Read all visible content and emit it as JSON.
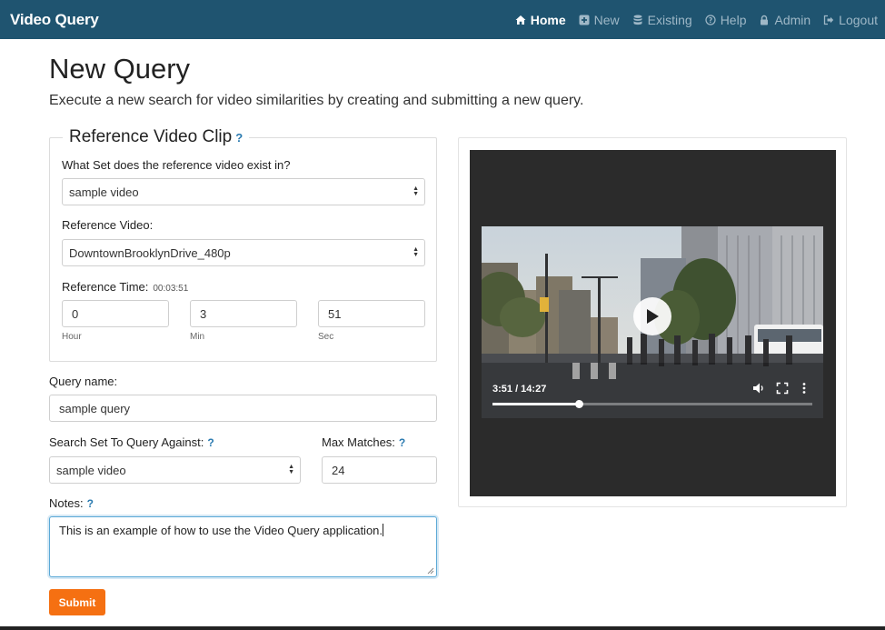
{
  "navbar": {
    "brand": "Video Query",
    "items": [
      {
        "label": "Home",
        "icon": "home-icon"
      },
      {
        "label": "New",
        "icon": "plus-square-icon"
      },
      {
        "label": "Existing",
        "icon": "database-icon"
      },
      {
        "label": "Help",
        "icon": "question-circle-icon"
      },
      {
        "label": "Admin",
        "icon": "lock-icon"
      },
      {
        "label": "Logout",
        "icon": "sign-out-icon"
      }
    ],
    "active": "Home",
    "bg_color": "#1f5470"
  },
  "page": {
    "title": "New Query",
    "subtitle": "Execute a new search for video similarities by creating and submitting a new query."
  },
  "reference": {
    "legend": "Reference Video Clip",
    "help": "?",
    "set_label": "What Set does the reference video exist in?",
    "set_value": "sample video",
    "video_label": "Reference Video:",
    "video_value": "DowntownBrooklynDrive_480p",
    "time_label": "Reference Time:",
    "time_value": "00:03:51",
    "hour": "0",
    "min": "3",
    "sec": "51",
    "hour_hint": "Hour",
    "min_hint": "Min",
    "sec_hint": "Sec"
  },
  "query": {
    "name_label": "Query name:",
    "name_value": "sample query",
    "search_set_label": "Search Set To Query Against:",
    "search_set_value": "sample video",
    "max_matches_label": "Max Matches:",
    "max_matches_value": "24",
    "notes_label": "Notes:",
    "notes_value": "This is an example of how to use the Video Query application.",
    "help": "?",
    "submit_label": "Submit",
    "submit_color": "#f57012"
  },
  "video": {
    "time": "3:51 / 14:27",
    "progress_fraction": 0.27
  }
}
